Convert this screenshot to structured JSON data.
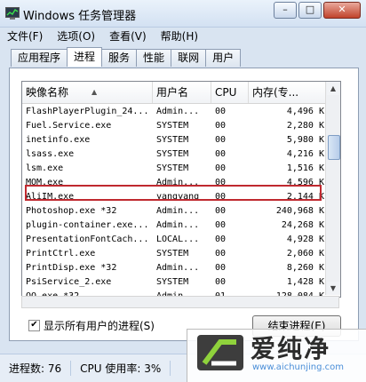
{
  "window": {
    "title": "Windows 任务管理器",
    "minimize": "–",
    "maximize": "□",
    "close": "✕"
  },
  "menu": [
    "文件(F)",
    "选项(O)",
    "查看(V)",
    "帮助(H)"
  ],
  "tabs": [
    "应用程序",
    "进程",
    "服务",
    "性能",
    "联网",
    "用户"
  ],
  "active_tab": "进程",
  "table": {
    "headers": [
      "映像名称",
      "用户名",
      "CPU",
      "内存(专..."
    ],
    "sort_indicator": "▲",
    "rows": [
      [
        "FlashPlayerPlugin_24...",
        "Admin...",
        "00",
        "4,496 K"
      ],
      [
        "Fuel.Service.exe",
        "SYSTEM",
        "00",
        "2,280 K"
      ],
      [
        "inetinfo.exe",
        "SYSTEM",
        "00",
        "5,980 K"
      ],
      [
        "lsass.exe",
        "SYSTEM",
        "00",
        "4,216 K"
      ],
      [
        "lsm.exe",
        "SYSTEM",
        "00",
        "1,516 K"
      ],
      [
        "MOM.exe",
        "Admin...",
        "00",
        "4,596 K"
      ],
      [
        "AliIM.exe",
        "yangyang",
        "00",
        "2,144 K"
      ],
      [
        "Photoshop.exe *32",
        "Admin...",
        "00",
        "240,968 K"
      ],
      [
        "plugin-container.exe...",
        "Admin...",
        "00",
        "24,268 K"
      ],
      [
        "PresentationFontCach...",
        "LOCAL...",
        "00",
        "4,928 K"
      ],
      [
        "PrintCtrl.exe",
        "SYSTEM",
        "00",
        "2,060 K"
      ],
      [
        "PrintDisp.exe *32",
        "Admin...",
        "00",
        "8,260 K"
      ],
      [
        "PsiService_2.exe",
        "SYSTEM",
        "00",
        "1,428 K"
      ],
      [
        "QQ.exe *32",
        "Admin...",
        "01",
        "128,084 K"
      ]
    ],
    "highlighted_row": 6,
    "highlight_color": "#c0292f"
  },
  "show_all_users": {
    "label": "显示所有用户的进程(S)",
    "checked": true,
    "mark": "✔"
  },
  "end_process_button": "结束进程(E)",
  "status": {
    "processes": "进程数: 76",
    "cpu": "CPU 使用率: 3%"
  },
  "watermark": {
    "title": "爱纯净",
    "url": "www.aichunjing.com"
  }
}
